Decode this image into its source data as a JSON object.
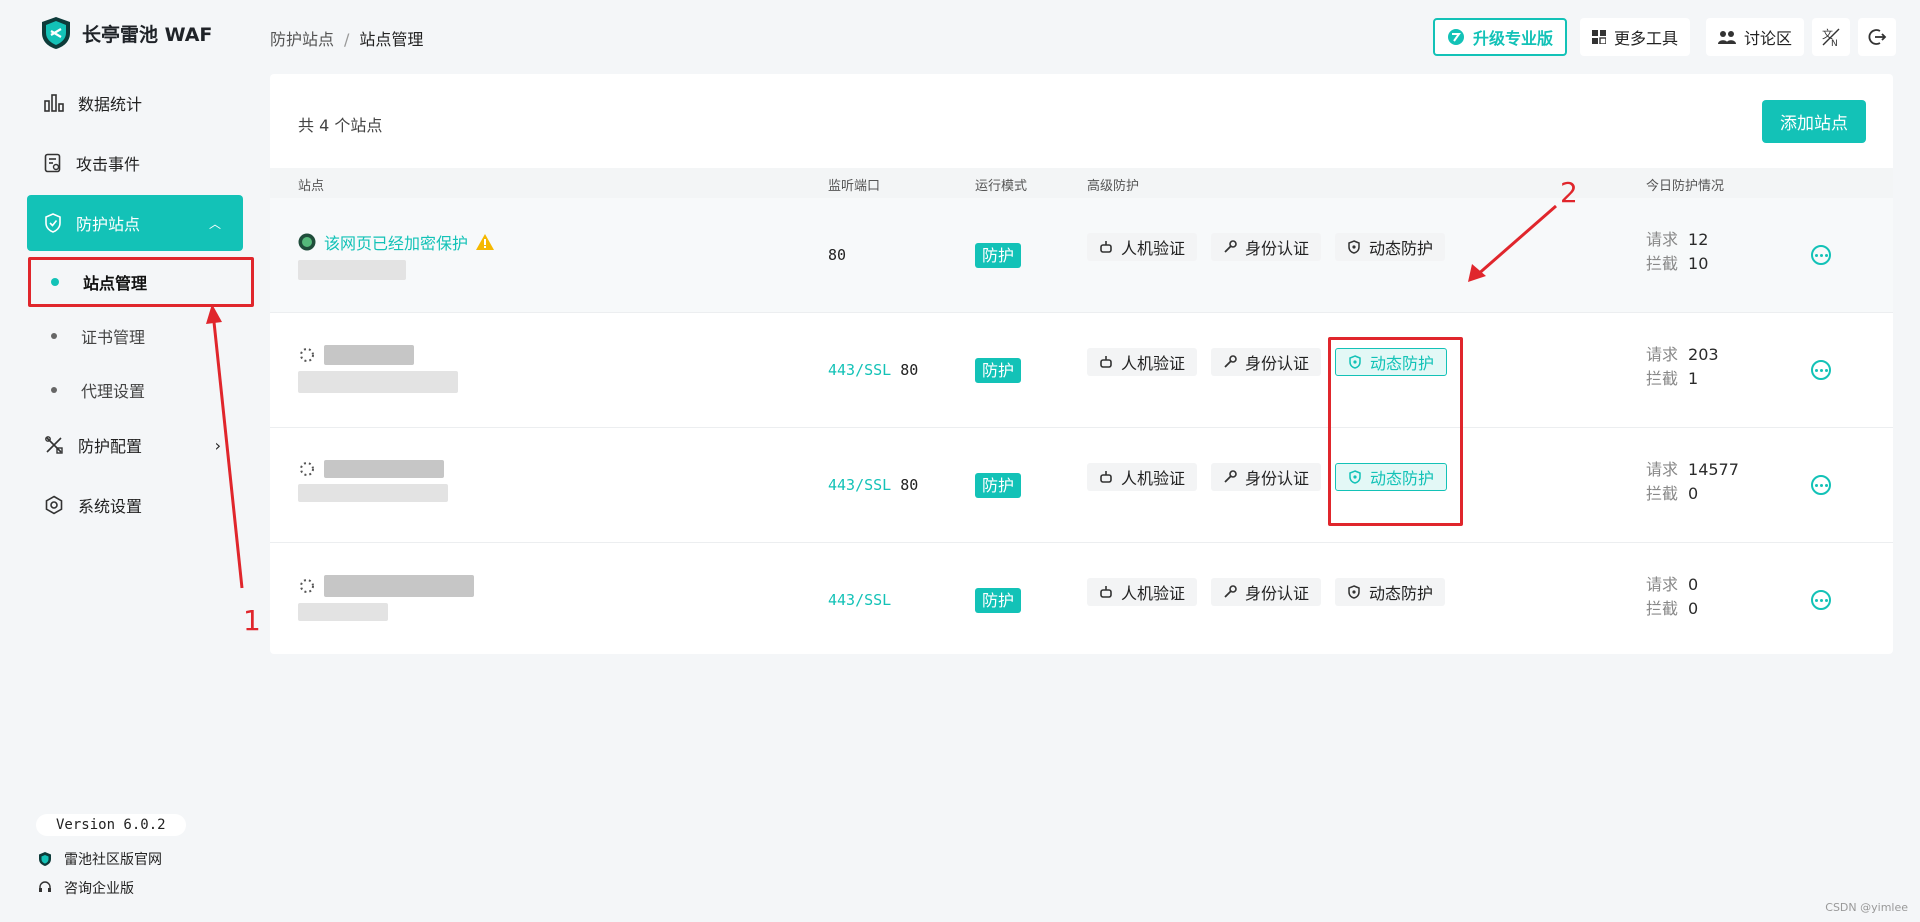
{
  "app": {
    "title": "长亭雷池 WAF"
  },
  "sidebar": {
    "items": [
      {
        "label": "数据统计"
      },
      {
        "label": "攻击事件"
      },
      {
        "label": "防护站点"
      },
      {
        "label": "防护配置"
      },
      {
        "label": "系统设置"
      }
    ],
    "sub_items": [
      {
        "label": "站点管理"
      },
      {
        "label": "证书管理"
      },
      {
        "label": "代理设置"
      }
    ],
    "version": "Version 6.0.2",
    "links": [
      {
        "label": "雷池社区版官网"
      },
      {
        "label": "咨询企业版"
      }
    ]
  },
  "header": {
    "breadcrumb": [
      "防护站点",
      "/",
      "站点管理"
    ],
    "buttons": {
      "upgrade": "升级专业版",
      "tools": "更多工具",
      "forum": "讨论区"
    }
  },
  "main": {
    "count_label": "共 4 个站点",
    "add_button": "添加站点",
    "columns": [
      "站点",
      "监听端口",
      "运行模式",
      "高级防护",
      "今日防护情况"
    ],
    "rows": [
      {
        "name": "该网页已经加密保护",
        "ports_ssl": "",
        "ports_plain": "80",
        "mode": "防护",
        "tags": [
          "人机验证",
          "身份认证",
          "动态防护"
        ],
        "request_label": "请求",
        "request": "12",
        "block_label": "拦截",
        "block": "10"
      },
      {
        "name": "",
        "ports_ssl": "443/SSL",
        "ports_plain": "80",
        "mode": "防护",
        "tags": [
          "人机验证",
          "身份认证",
          "动态防护"
        ],
        "request_label": "请求",
        "request": "203",
        "block_label": "拦截",
        "block": "1"
      },
      {
        "name": "",
        "ports_ssl": "443/SSL",
        "ports_plain": "80",
        "mode": "防护",
        "tags": [
          "人机验证",
          "身份认证",
          "动态防护"
        ],
        "request_label": "请求",
        "request": "14577",
        "block_label": "拦截",
        "block": "0"
      },
      {
        "name": "",
        "ports_ssl": "443/SSL",
        "ports_plain": "",
        "mode": "防护",
        "tags": [
          "人机验证",
          "身份认证",
          "动态防护"
        ],
        "request_label": "请求",
        "request": "0",
        "block_label": "拦截",
        "block": "0"
      }
    ]
  },
  "annotations": {
    "label_1": "1",
    "label_2": "2"
  },
  "watermark": "CSDN @yimlee",
  "colors": {
    "accent": "#13c2b7",
    "annotation": "#e0262c",
    "warning": "#f5b800"
  }
}
